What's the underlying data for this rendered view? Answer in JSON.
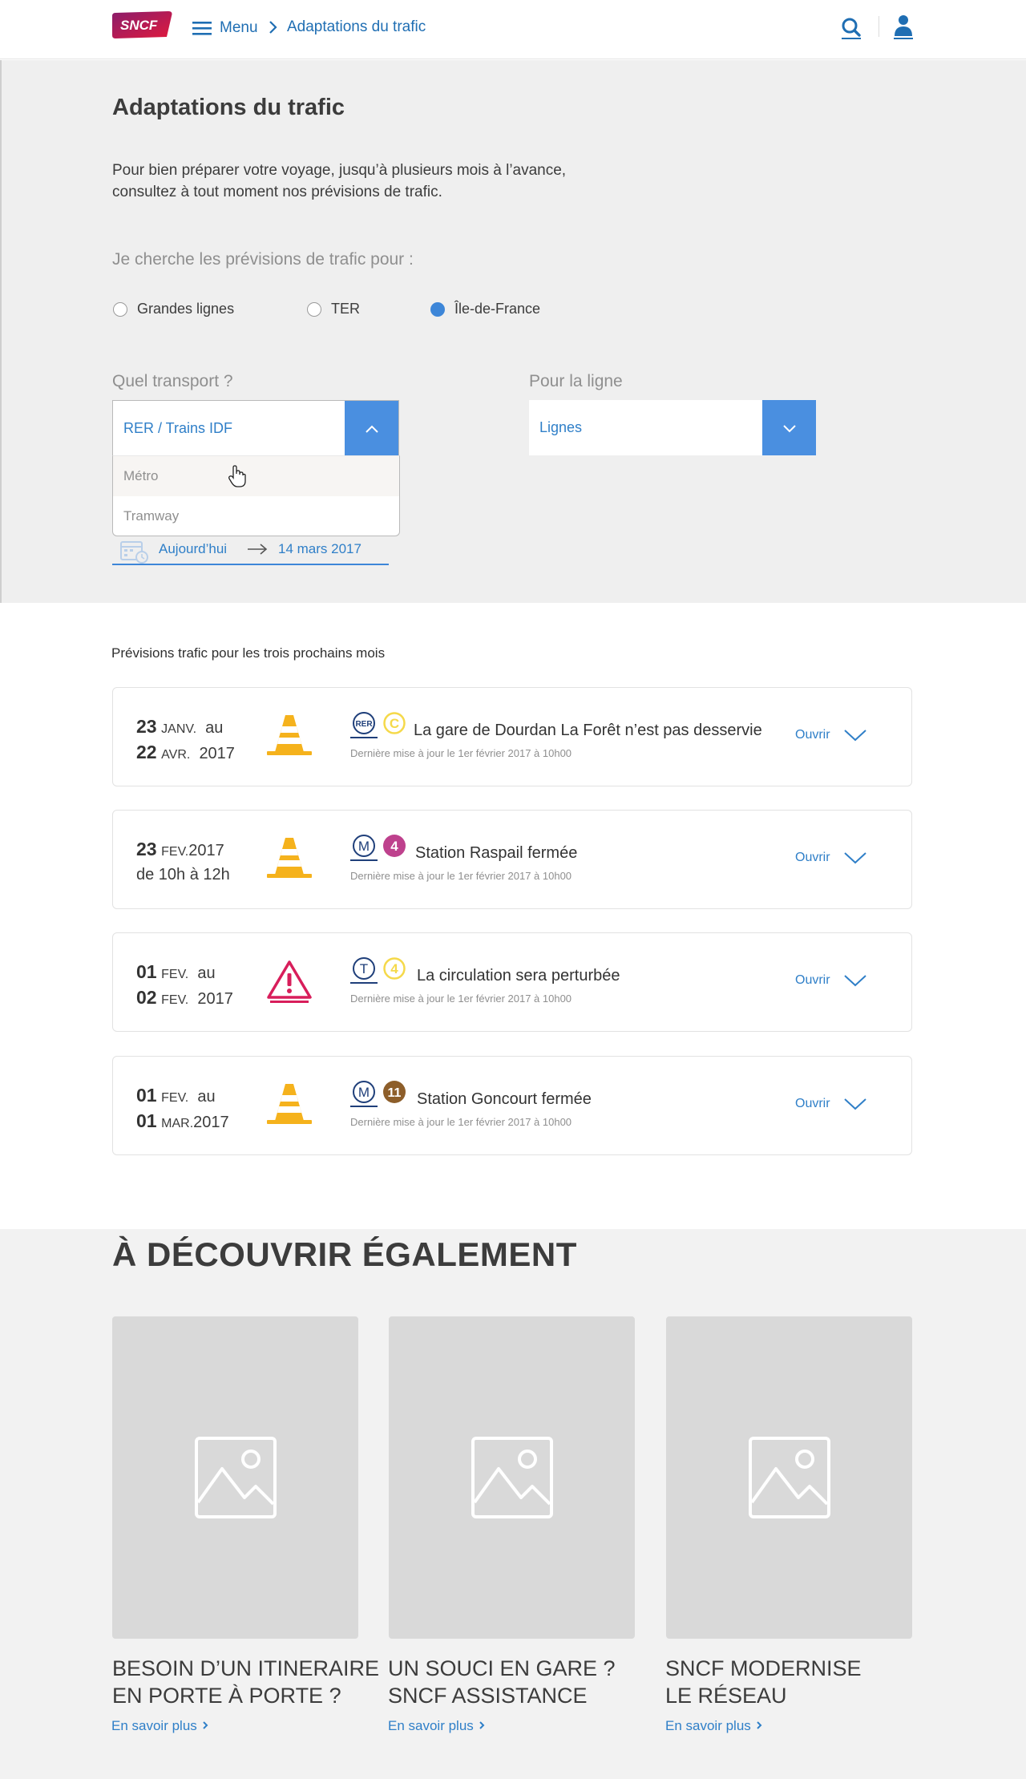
{
  "header": {
    "menu_label": "Menu",
    "breadcrumb_current": "Adaptations du trafic",
    "logo_text": "SNCF"
  },
  "filters": {
    "title": "Adaptations du trafic",
    "intro_line1": "Pour bien préparer votre voyage, jusqu’à plusieurs mois à l’avance,",
    "intro_line2": "consultez à tout moment nos prévisions de trafic.",
    "question": "Je cherche les prévisions de trafic pour :",
    "radios": [
      {
        "label": "Grandes lignes",
        "selected": false
      },
      {
        "label": "TER",
        "selected": false
      },
      {
        "label": "Île-de-France",
        "selected": true
      }
    ],
    "transport_label": "Quel transport ?",
    "transport_value": "RER / Trains IDF",
    "transport_options": [
      "Métro",
      "Tramway"
    ],
    "line_label": "Pour la ligne",
    "line_value": "Lignes",
    "date_from": "Aujourd’hui",
    "date_to": "14 mars 2017"
  },
  "list": {
    "title": "Prévisions trafic pour les trois prochains mois",
    "open_label": "Ouvrir",
    "items": [
      {
        "d1": "23",
        "m1": "JANV.",
        "w1": "au",
        "d2": "22",
        "m2": "AVR.",
        "y2": "2017",
        "icon": "traffic-cone-icon",
        "mode_badge": "RER",
        "line_badge": "C",
        "line_color": "#f5d94a",
        "headline": "La gare de Dourdan La Forêt n’est pas desservie",
        "updated": "Dernière mise à jour le 1er février 2017 à 10h00"
      },
      {
        "d1": "23",
        "m1": "FEV.",
        "w1": "2017",
        "line2": "de 10h à 12h",
        "icon": "traffic-cone-icon",
        "mode_badge": "M",
        "line_badge": "4",
        "line_color": "#be418d",
        "headline": "Station Raspail fermée",
        "updated": "Dernière mise à jour le 1er février 2017 à 10h00"
      },
      {
        "d1": "01",
        "m1": "FEV.",
        "w1": "au",
        "d2": "02",
        "m2": "FEV.",
        "y2": "2017",
        "icon": "warning-triangle-icon",
        "mode_badge": "T",
        "line_badge": "4",
        "line_color": "#f5d94a",
        "headline": "La circulation sera perturbée",
        "updated": "Dernière mise à jour le 1er février 2017 à 10h00"
      },
      {
        "d1": "01",
        "m1": "FEV.",
        "w1": "au",
        "d2": "01",
        "m2": "MAR.",
        "y2": "2017",
        "icon": "traffic-cone-icon",
        "mode_badge": "M",
        "line_badge": "11",
        "line_color": "#8d5e2a",
        "headline": "Station Goncourt fermée",
        "updated": "Dernière mise à jour le 1er février 2017 à 10h00"
      }
    ]
  },
  "discover": {
    "title": "À DÉCOUVRIR ÉGALEMENT",
    "link_label": "En savoir plus",
    "tiles": [
      {
        "line1": "BESOIN D’UN ITINERAIRE",
        "line2": "EN PORTE À PORTE ?"
      },
      {
        "line1": "UN SOUCI EN GARE ?",
        "line2": "SNCF ASSISTANCE"
      },
      {
        "line1": "SNCF MODERNISE",
        "line2": "LE RÉSEAU"
      }
    ]
  },
  "colors": {
    "accent": "#2f7fc8",
    "button_blue": "#4a8fe0",
    "cone": "#f5b21c",
    "warning": "#d81e5b",
    "brand": "#b0155c"
  }
}
